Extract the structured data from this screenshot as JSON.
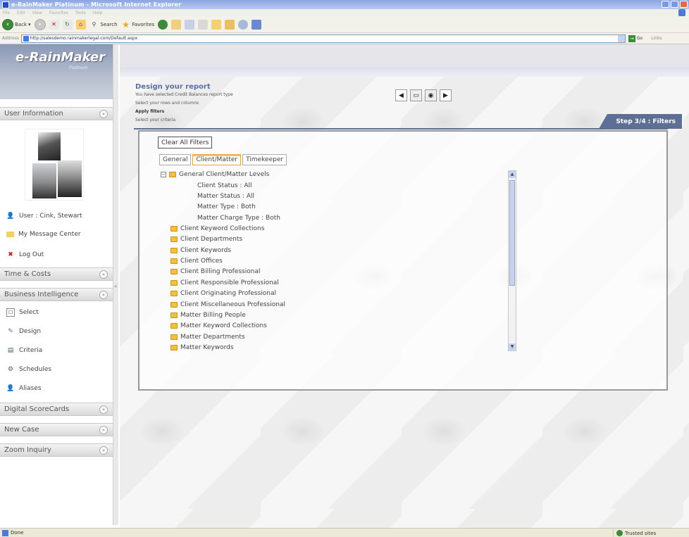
{
  "window": {
    "title": "e-RainMaker Platinum - Microsoft Internet Explorer"
  },
  "menu": [
    "File",
    "Edit",
    "View",
    "Favorites",
    "Tools",
    "Help"
  ],
  "toolbar": {
    "back": "Back",
    "search": "Search",
    "favorites": "Favorites"
  },
  "address": {
    "label": "Address",
    "url": "http://salesdemo.rainmakerlegal.com/Default.aspx",
    "go": "Go",
    "links": "Links"
  },
  "logo": {
    "text": "e-RainMaker",
    "sub": "Platinum"
  },
  "sidebar": {
    "user_info": "User Information",
    "user": "User : Cink, Stewart",
    "message_center": "My Message Center",
    "logout": "Log Out",
    "time_costs": "Time & Costs",
    "business_intel": "Business Intelligence",
    "bi_items": [
      "Select",
      "Design",
      "Criteria",
      "Schedules",
      "Aliases"
    ],
    "scorecards": "Digital ScoreCards",
    "new_case": "New Case",
    "zoom": "Zoom Inquiry"
  },
  "main": {
    "design_title": "Design your report",
    "line1": "You have selected Credit Balances report type",
    "line2": "Select your rows and columns",
    "line3": "Apply filters",
    "line4": "Select your criteria",
    "step": "Step 3/4 : Filters",
    "clear_filters": "Clear All Filters",
    "tabs": [
      "General",
      "Client/Matter",
      "Timekeeper"
    ],
    "tree_root": "General Client/Matter Levels",
    "tree_children": [
      "Client Status : All",
      "Matter Status : All",
      "Matter Type : Both",
      "Matter Charge Type : Both"
    ],
    "tree_folders": [
      "Client Keyword Collections",
      "Client Departments",
      "Client Keywords",
      "Client Offices",
      "Client Billing Professional",
      "Client Responsible Professional",
      "Client Originating Professional",
      "Client Miscellaneous Professional",
      "Matter Billing People",
      "Matter Keyword Collections",
      "Matter Departments",
      "Matter Keywords"
    ]
  },
  "status": {
    "left": "Done",
    "zone": "Trusted sites"
  }
}
